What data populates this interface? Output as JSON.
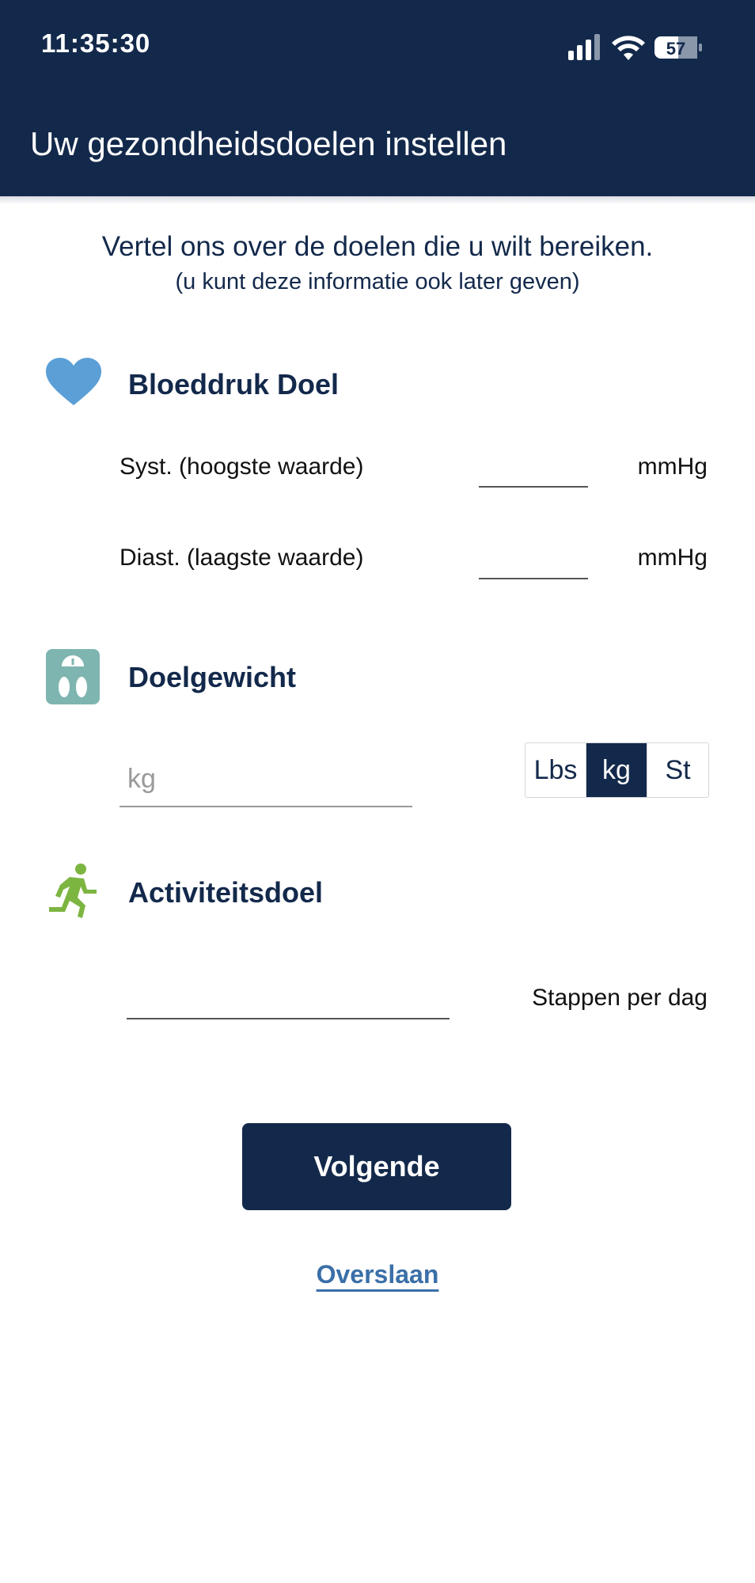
{
  "status_bar": {
    "time": "11:35:30",
    "battery": "57",
    "icons": [
      "signal-icon",
      "wifi-icon",
      "battery-icon"
    ]
  },
  "header": {
    "title": "Uw gezondheidsdoelen instellen"
  },
  "intro": {
    "main": "Vertel ons over de doelen die u wilt bereiken.",
    "sub": "(u kunt deze informatie ook later geven)"
  },
  "blood_pressure": {
    "title": "Bloeddruk Doel",
    "icon": "heart-icon",
    "systolic_label": "Syst. (hoogste waarde)",
    "systolic_value": "",
    "systolic_unit": "mmHg",
    "diastolic_label": "Diast. (laagste waarde)",
    "diastolic_value": "",
    "diastolic_unit": "mmHg"
  },
  "weight": {
    "title": "Doelgewicht",
    "icon": "scale-icon",
    "placeholder": "kg",
    "value": "",
    "units": [
      "Lbs",
      "kg",
      "St"
    ],
    "selected_unit": "kg"
  },
  "activity": {
    "title": "Activiteitsdoel",
    "icon": "running-person-icon",
    "value": "",
    "unit": "Stappen per dag"
  },
  "actions": {
    "next_label": "Volgende",
    "skip_label": "Overslaan"
  },
  "colors": {
    "primary": "#13294b",
    "heart": "#5b9fd6",
    "scale": "#7fb5b0",
    "activity": "#7db541",
    "link": "#3a6fa8"
  }
}
